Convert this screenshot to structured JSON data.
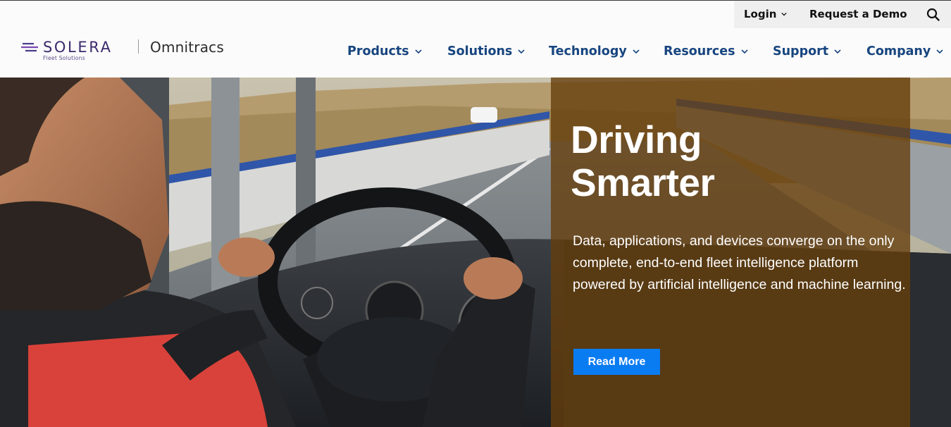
{
  "utility_nav": {
    "login_label": "Login",
    "request_demo_label": "Request a Demo",
    "search_icon": "search-icon"
  },
  "logo": {
    "brand": "SOLERA",
    "tagline": "Fleet Solutions",
    "partner": "Omnitracs"
  },
  "main_nav": {
    "items": [
      {
        "label": "Products"
      },
      {
        "label": "Solutions"
      },
      {
        "label": "Technology"
      },
      {
        "label": "Resources"
      },
      {
        "label": "Support"
      },
      {
        "label": "Company"
      }
    ]
  },
  "hero": {
    "title_line1": "Driving",
    "title_line2": "Smarter",
    "description": "Data, applications, and devices converge on the only complete, end-to-end fleet intelligence platform powered by artificial intelligence and machine learning.",
    "cta_label": "Read More"
  },
  "colors": {
    "nav_text": "#17457f",
    "brand_purple": "#3b2a6b",
    "overlay_brown": "#653d0c",
    "cta_blue": "#0a7cf2"
  }
}
